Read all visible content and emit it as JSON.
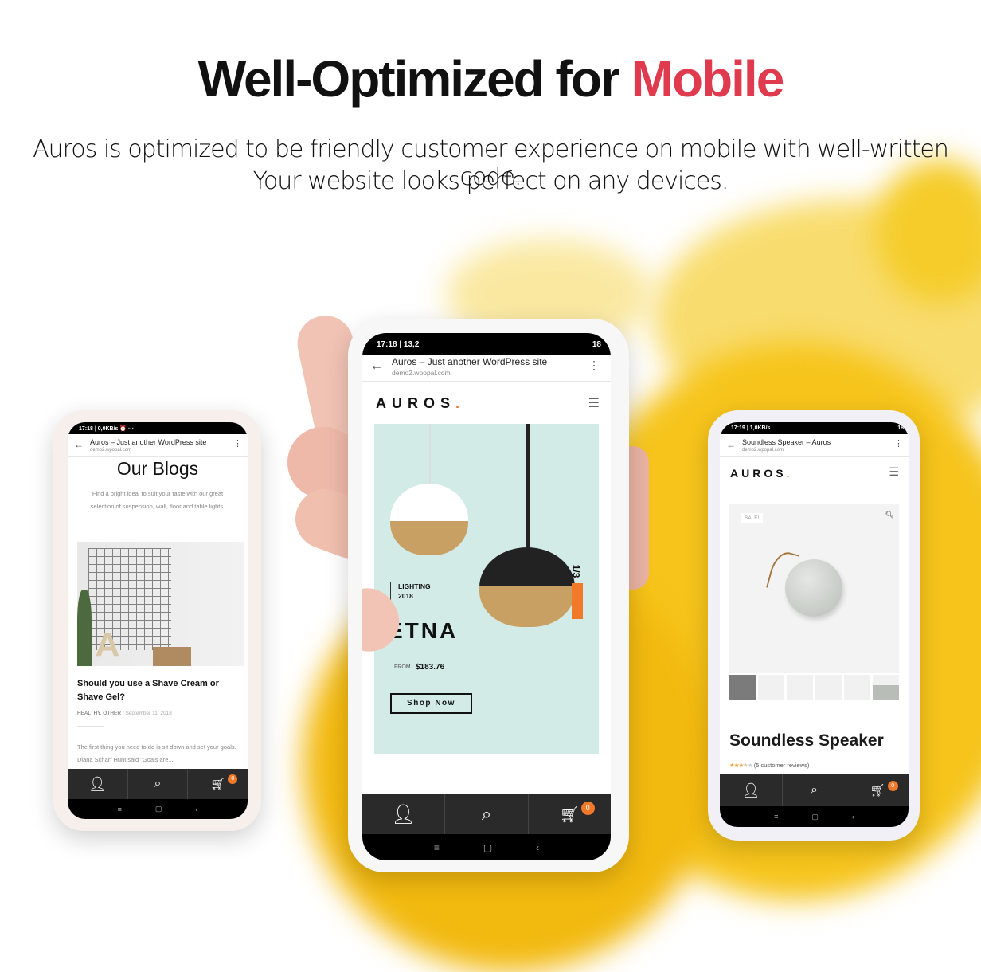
{
  "headline": {
    "prefix": "Well-Optimized for ",
    "accent": "Mobile",
    "accent_color": "#e03a4e"
  },
  "subtitle": [
    "Auros is optimized to be friendly customer experience on mobile with well-written code.",
    "Your website looks perfect on any devices."
  ],
  "left_phone": {
    "status": "17:18 | 0,0KB/s ⏰ ···",
    "browser_title": "Auros – Just another WordPress site",
    "browser_url": "demo2.wpopal.com",
    "page_title": "Our Blogs",
    "intro": [
      "Find a bright ideal to suit your taste with our great",
      "selection of suspension, wall, floor and table lights."
    ],
    "post": {
      "title": "Should you use a Shave Cream or Shave Gel?",
      "categories": "HEALTHY, OTHER",
      "separator": "/",
      "date": "September 11, 2018",
      "excerpt": "The first thing you need to do is sit down and set your goals. Diana Scharf Hunt said \"Goals are..."
    },
    "cart_count": "0",
    "icons": [
      "user-icon",
      "search-icon",
      "cart-icon"
    ]
  },
  "center_phone": {
    "status": "17:18 | 13,2",
    "status_right": "18",
    "browser_title": "Auros – Just another WordPress site",
    "browser_url": "demo2.wpopal.com",
    "logo": "AUROS",
    "logo_dot": ".",
    "hero": {
      "eyebrow": "LIGHTING",
      "year": "2018",
      "name": "ETNA",
      "from_label": "FROM",
      "price": "$183.76",
      "button": "Shop Now",
      "slide": "1/3",
      "bg_color": "#d3ebe6"
    },
    "cart_count": "0"
  },
  "right_phone": {
    "status": "17:19 | 1,0KB/s",
    "status_right": "18",
    "browser_title": "Soundless Speaker – Auros",
    "browser_url": "demo2.wpopal.com",
    "logo": "AUROS",
    "logo_dot": ".",
    "sale_badge": "SALE!",
    "product_title": "Soundless Speaker",
    "rating": 3.5,
    "reviews": "(5 customer reviews)",
    "thumbnails": 6,
    "cart_count": "0"
  },
  "colors": {
    "accent": "#f07a2a",
    "nav_bg": "#2a2a2a",
    "splash": "#f5c518"
  }
}
